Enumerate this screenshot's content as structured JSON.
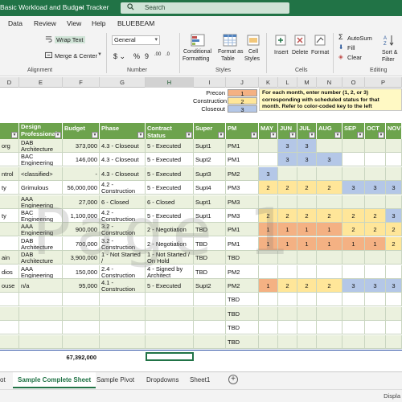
{
  "window": {
    "title": "Basic Workload and Budget Tracker",
    "title_chevron": "⌄",
    "search_placeholder": "Search"
  },
  "menu": [
    "Data",
    "Review",
    "View",
    "Help",
    "BLUEBEAM"
  ],
  "ribbon": {
    "wrap_text": "Wrap Text",
    "merge_center": "Merge & Center",
    "number_format": "General",
    "currency": "$ ⌄",
    "percent": "%",
    "comma": "9",
    "dec_inc": ".00",
    "dec_dec": ".0",
    "conditional_formatting": [
      "Conditional",
      "Formatting"
    ],
    "format_as_table": [
      "Format as",
      "Table"
    ],
    "cell_styles": [
      "Cell",
      "Styles"
    ],
    "insert": "Insert",
    "delete": "Delete",
    "format": "Format",
    "autosum": "AutoSum",
    "fill": "Fill",
    "clear": "Clear",
    "sort_filter": [
      "Sort &",
      "Filter"
    ],
    "groups": {
      "alignment": "Alignment",
      "number": "Number",
      "styles": "Styles",
      "cells": "Cells",
      "editing": "Editing"
    }
  },
  "columns": [
    "D",
    "E",
    "F",
    "G",
    "H",
    "I",
    "J",
    "K",
    "L",
    "M",
    "N",
    "O",
    "P"
  ],
  "key": {
    "precon_label": "Precon",
    "precon_value": "1",
    "construction_label": "Construction",
    "construction_value": "2",
    "closeout_label": "Closeout",
    "closeout_value": "3",
    "note": "For each month, enter number (1, 2, or 3) corresponding with scheduled status for that month. Refer to color-coded key to the left",
    "colors": {
      "precon": "#f4b183",
      "construction": "#ffe699",
      "closeout": "#b4c7e7"
    }
  },
  "headers": {
    "design": [
      "Design",
      "Professional"
    ],
    "budget": "Budget",
    "phase": "Phase",
    "contract_status": "Contract Status",
    "super": "Super",
    "pm": "PM",
    "months": [
      "MAY",
      "JUN",
      "JUL",
      "AUG",
      "SEP",
      "OCT",
      "NOV"
    ]
  },
  "rows": [
    {
      "d": "org",
      "e1": "DAB",
      "e2": "Architecture",
      "f": "373,000",
      "g1": "4.3 - Closeout",
      "g2": "",
      "h": "5 - Executed",
      "i": "Supt1",
      "j": "PM1",
      "m": [
        "",
        "3",
        "3",
        "",
        "",
        "",
        ""
      ],
      "bg": "light"
    },
    {
      "d": "",
      "e1": "BAC",
      "e2": "Engineering",
      "f": "146,000",
      "g1": "4.3 - Closeout",
      "g2": "",
      "h": "5 - Executed",
      "i": "Supt2",
      "j": "PM1",
      "m": [
        "",
        "3",
        "3",
        "3",
        "",
        "",
        ""
      ],
      "bg": "white"
    },
    {
      "d": "ntrol",
      "e1": "<classified>",
      "e2": "",
      "f": "-",
      "g1": "4.3 - Closeout",
      "g2": "",
      "h": "5 - Executed",
      "i": "Supt3",
      "j": "PM2",
      "m": [
        "3",
        "",
        "",
        "",
        "",
        "",
        ""
      ],
      "bg": "light"
    },
    {
      "d": "ty",
      "e1": "Grimulous",
      "e2": "",
      "f": "56,000,000",
      "g1": "4.2 - Construction",
      "g2": "In Progress",
      "h": "5 - Executed",
      "i": "Supt4",
      "j": "PM3",
      "m": [
        "2",
        "2",
        "2",
        "2",
        "3",
        "3",
        "3"
      ],
      "bg": "white"
    },
    {
      "d": "",
      "e1": "AAA",
      "e2": "Engineering",
      "f": "27,000",
      "g1": "6 - Closed",
      "g2": "",
      "h": "6 - Closed",
      "i": "Supt1",
      "j": "PM3",
      "m": [
        "",
        "",
        "",
        "",
        "",
        "",
        ""
      ],
      "bg": "light"
    },
    {
      "d": "ty",
      "e1": "BAC",
      "e2": "Engineering",
      "f": "1,100,000",
      "g1": "4.2 - Construction",
      "g2": "In Progress",
      "h": "5 - Executed",
      "i": "Supt1",
      "j": "PM3",
      "m": [
        "2",
        "2",
        "2",
        "2",
        "2",
        "2",
        "3"
      ],
      "bg": "white"
    },
    {
      "d": "",
      "e1": "AAA",
      "e2": "Engineering",
      "f": "900,000",
      "g1": "3.2 - Construction",
      "g2": "Pricing - GMP",
      "h": "2 - Negotiation",
      "i": "TBD",
      "j": "PM1",
      "m": [
        "1",
        "1",
        "1",
        "1",
        "2",
        "2",
        "2"
      ],
      "bg": "light"
    },
    {
      "d": "",
      "e1": "DAB",
      "e2": "Architecture",
      "f": "700,000",
      "g1": "3.2 - Construction",
      "g2": "Pricing - GMP",
      "h": "2 - Negotiation",
      "i": "TBD",
      "j": "PM1",
      "m": [
        "1",
        "1",
        "1",
        "1",
        "1",
        "1",
        "2"
      ],
      "bg": "white"
    },
    {
      "d": "ain",
      "e1": "DAB",
      "e2": "Architecture",
      "f": "3,900,000",
      "g1": "1 - Not Started /",
      "g2": "On Hold",
      "h": "1 - Not Started /",
      "h2": "On Hold",
      "i": "TBD",
      "j": "TBD",
      "m": [
        "",
        "",
        "",
        "",
        "",
        "",
        ""
      ],
      "bg": "light"
    },
    {
      "d": "dios",
      "e1": "AAA",
      "e2": "Engineering",
      "f": "150,000",
      "g1": "2.4 - Construction",
      "g2": "Documents",
      "h": "4 - Signed by",
      "h2": "Architect",
      "i": "TBD",
      "j": "PM2",
      "m": [
        "",
        "",
        "",
        "",
        "",
        "",
        ""
      ],
      "bg": "white"
    },
    {
      "d": "ouse",
      "e1": "n/a",
      "e2": "",
      "f": "95,000",
      "g1": "4.1 - Construction",
      "g2": "Scheduled",
      "h": "5 - Executed",
      "i": "Supt2",
      "j": "PM2",
      "m": [
        "1",
        "2",
        "2",
        "2",
        "3",
        "3",
        "3"
      ],
      "bg": "light"
    },
    {
      "d": "",
      "e1": "",
      "e2": "",
      "f": "",
      "g1": "",
      "g2": "",
      "h": "",
      "i": "",
      "j": "TBD",
      "m": [
        "",
        "",
        "",
        "",
        "",
        "",
        ""
      ],
      "bg": "white"
    },
    {
      "d": "",
      "e1": "",
      "e2": "",
      "f": "",
      "g1": "",
      "g2": "",
      "h": "",
      "i": "",
      "j": "TBD",
      "m": [
        "",
        "",
        "",
        "",
        "",
        "",
        ""
      ],
      "bg": "light"
    },
    {
      "d": "",
      "e1": "",
      "e2": "",
      "f": "",
      "g1": "",
      "g2": "",
      "h": "",
      "i": "",
      "j": "TBD",
      "m": [
        "",
        "",
        "",
        "",
        "",
        "",
        ""
      ],
      "bg": "white"
    },
    {
      "d": "",
      "e1": "",
      "e2": "",
      "f": "",
      "g1": "",
      "g2": "",
      "h": "",
      "i": "",
      "j": "TBD",
      "m": [
        "",
        "",
        "",
        "",
        "",
        "",
        ""
      ],
      "bg": "light"
    }
  ],
  "total_budget": "67,392,000",
  "watermark": "Page 1",
  "sheet_tabs": {
    "partial": "ot",
    "active": "Sample Complete Sheet",
    "others": [
      "Sample Pivot",
      "Dropdowns",
      "Sheet1"
    ],
    "add": "+"
  },
  "status": {
    "display_settings": "Displa"
  }
}
